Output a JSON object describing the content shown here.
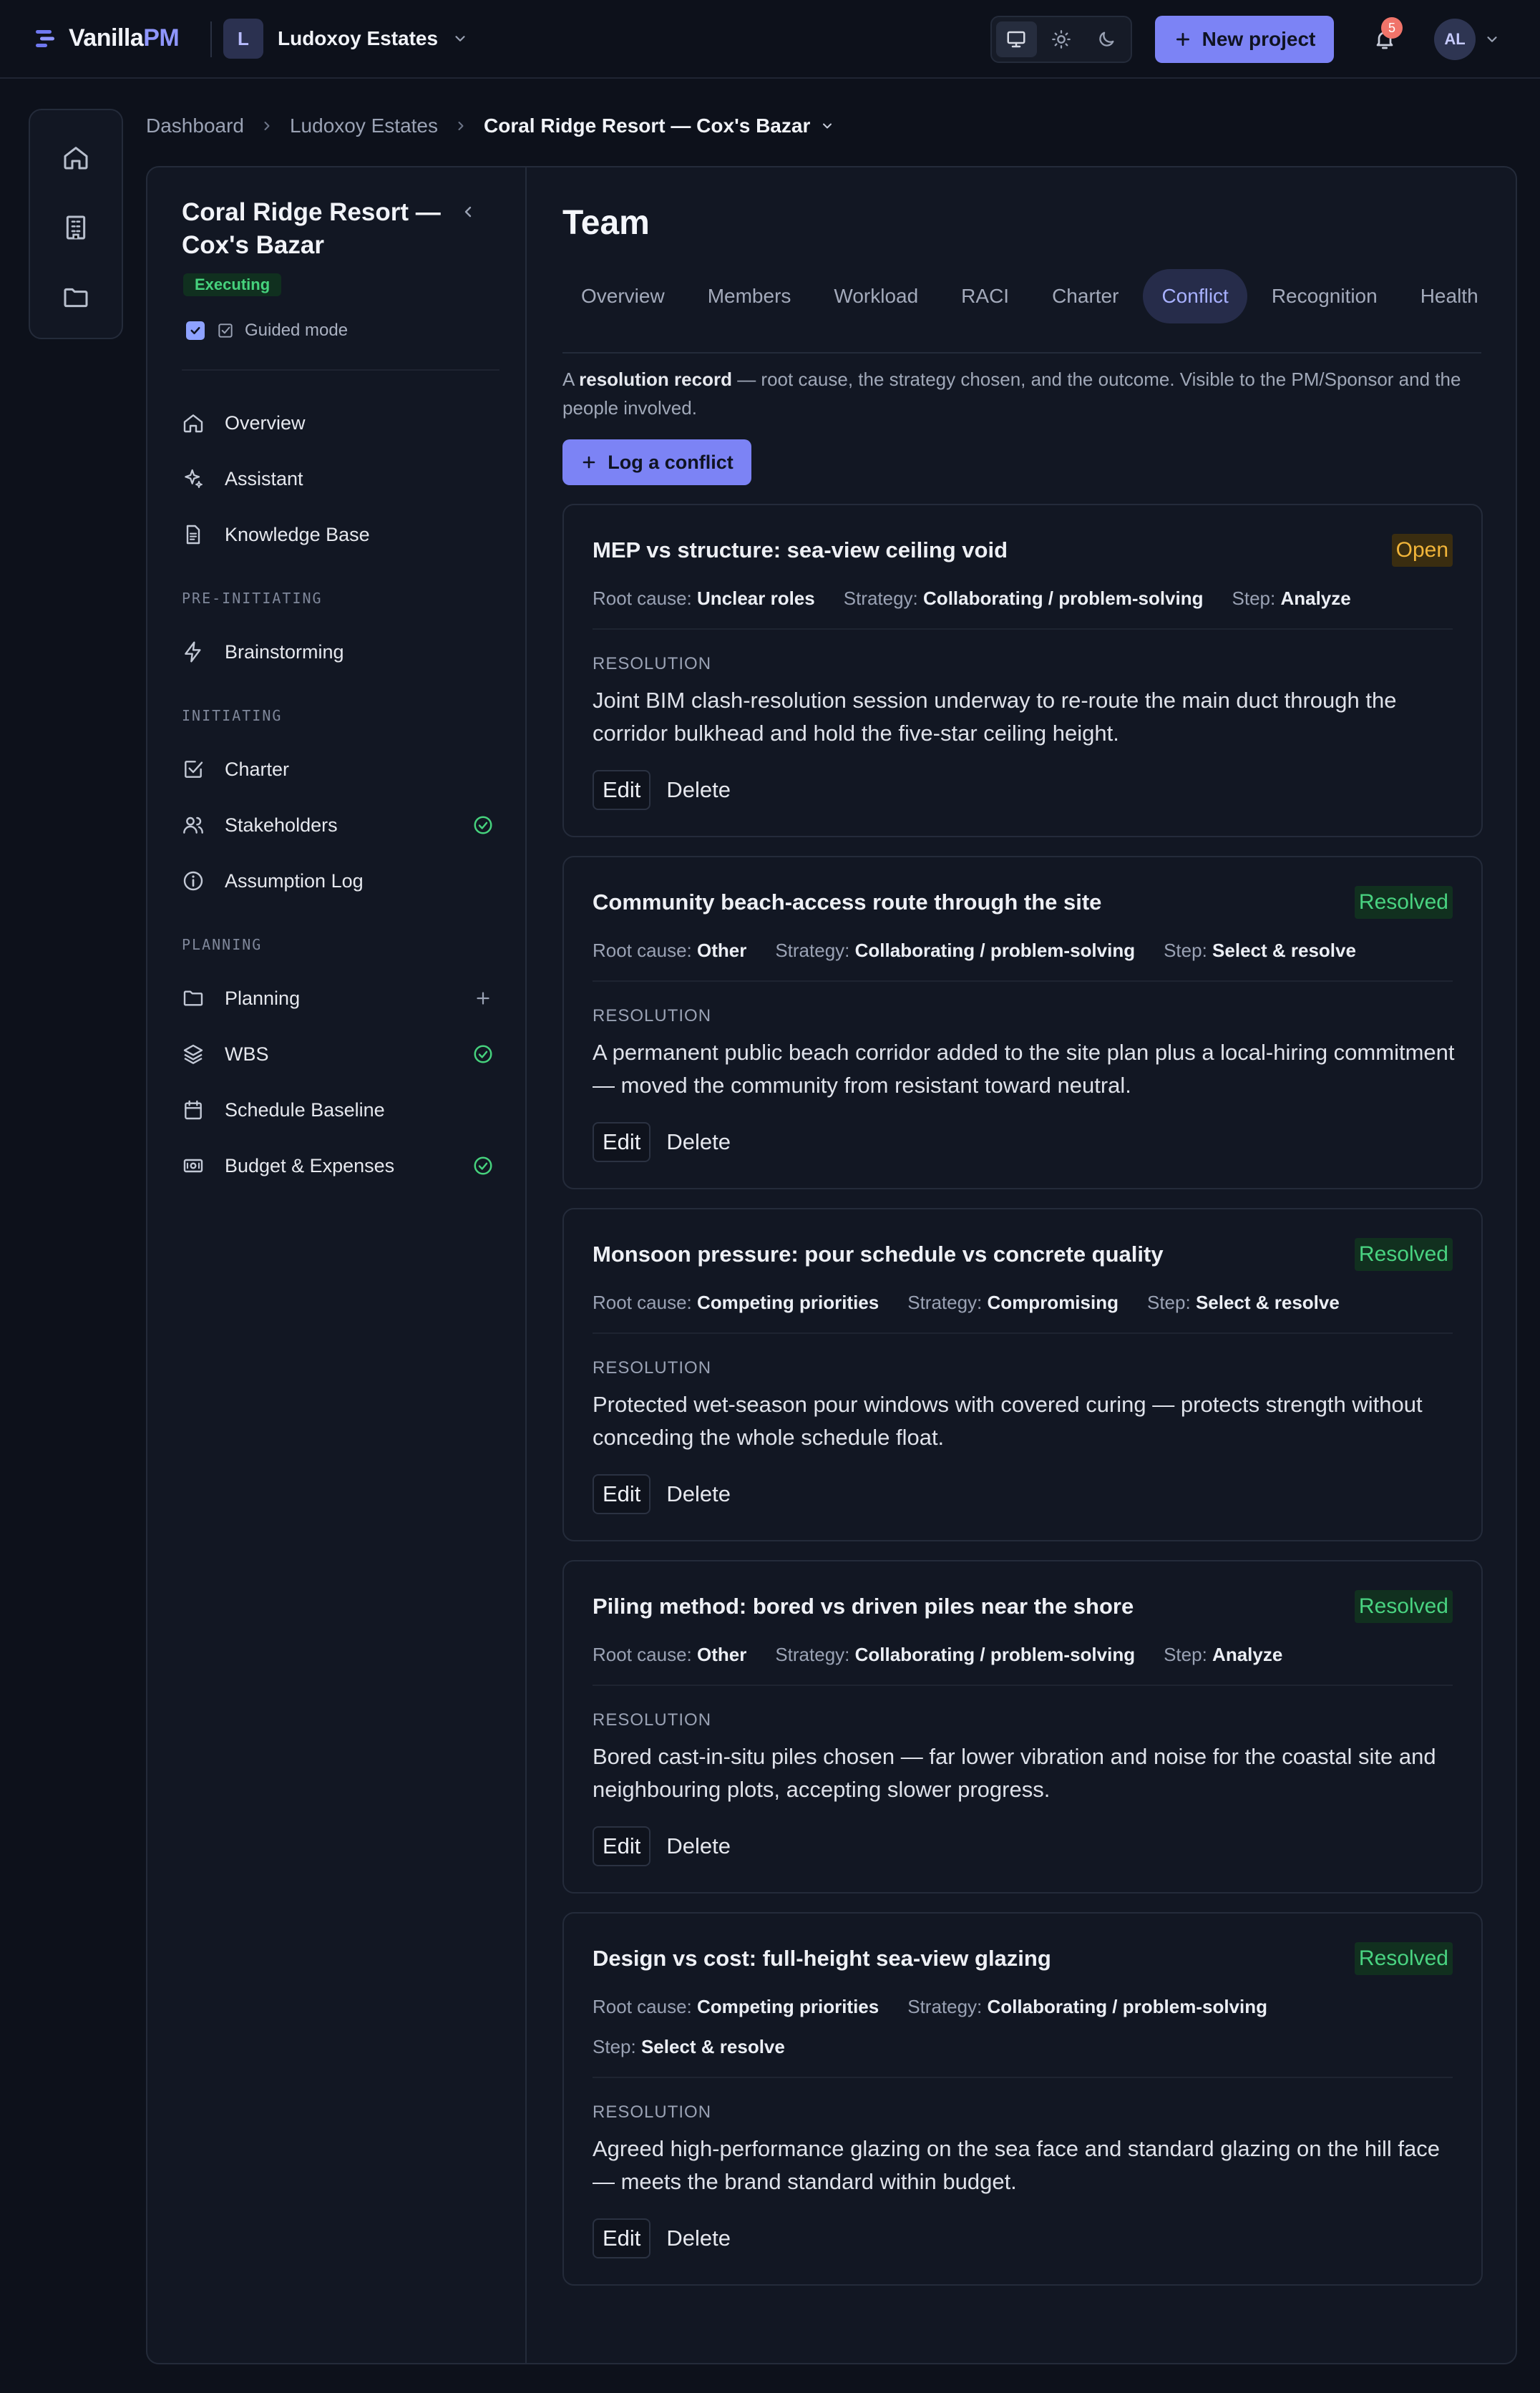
{
  "app": {
    "name_plain": "Vanilla",
    "name_accent": "PM",
    "workspace_initial": "L",
    "workspace_name": "Ludoxoy Estates",
    "new_project_label": "New project",
    "notification_count": "5",
    "user_initials": "AL",
    "accent_color": "#7c83f5"
  },
  "breadcrumb": {
    "items": [
      "Dashboard",
      "Ludoxoy Estates"
    ],
    "current": "Coral Ridge Resort — Cox's Bazar"
  },
  "sidebar": {
    "project_title": "Coral Ridge Resort — Cox's Bazar",
    "status": "Executing",
    "guided_mode_label": "Guided mode",
    "guided_mode_checked": true,
    "top_items": [
      {
        "label": "Overview",
        "icon": "home-icon"
      },
      {
        "label": "Assistant",
        "icon": "sparkle-icon"
      },
      {
        "label": "Knowledge Base",
        "icon": "document-icon"
      }
    ],
    "sections": [
      {
        "title": "PRE-INITIATING",
        "items": [
          {
            "label": "Brainstorming",
            "icon": "bolt-icon"
          }
        ]
      },
      {
        "title": "INITIATING",
        "items": [
          {
            "label": "Charter",
            "icon": "checkbox-icon"
          },
          {
            "label": "Stakeholders",
            "icon": "users-icon",
            "trail": "check-circle-icon"
          },
          {
            "label": "Assumption Log",
            "icon": "info-icon"
          }
        ]
      },
      {
        "title": "PLANNING",
        "items": [
          {
            "label": "Planning",
            "icon": "folder-icon",
            "trail": "plus-icon"
          },
          {
            "label": "WBS",
            "icon": "layers-icon",
            "trail": "check-circle-icon"
          },
          {
            "label": "Schedule Baseline",
            "icon": "calendar-icon"
          },
          {
            "label": "Budget & Expenses",
            "icon": "money-icon",
            "trail": "check-circle-icon"
          }
        ]
      }
    ]
  },
  "main": {
    "title": "Team",
    "tabs": [
      "Overview",
      "Members",
      "Workload",
      "RACI",
      "Charter",
      "Conflict",
      "Recognition",
      "Health"
    ],
    "active_tab": "Conflict",
    "intro_prefix": "A ",
    "intro_bold": "resolution record",
    "intro_suffix": " — root cause, the strategy chosen, and the outcome. Visible to the PM/Sponsor and the people involved.",
    "log_button_label": "Log a conflict",
    "labels": {
      "root_cause": "Root cause:",
      "strategy": "Strategy:",
      "step": "Step:",
      "resolution": "RESOLUTION",
      "edit": "Edit",
      "delete": "Delete"
    },
    "conflicts": [
      {
        "title": "MEP vs structure: sea-view ceiling void",
        "status": "Open",
        "root_cause": "Unclear roles",
        "strategy": "Collaborating / problem-solving",
        "step": "Analyze",
        "resolution": "Joint BIM clash-resolution session underway to re-route the main duct through the corridor bulkhead and hold the five-star ceiling height."
      },
      {
        "title": "Community beach-access route through the site",
        "status": "Resolved",
        "root_cause": "Other",
        "strategy": "Collaborating / problem-solving",
        "step": "Select & resolve",
        "resolution": "A permanent public beach corridor added to the site plan plus a local-hiring commitment — moved the community from resistant toward neutral."
      },
      {
        "title": "Monsoon pressure: pour schedule vs concrete quality",
        "status": "Resolved",
        "root_cause": "Competing priorities",
        "strategy": "Compromising",
        "step": "Select & resolve",
        "resolution": "Protected wet-season pour windows with covered curing — protects strength without conceding the whole schedule float."
      },
      {
        "title": "Piling method: bored vs driven piles near the shore",
        "status": "Resolved",
        "root_cause": "Other",
        "strategy": "Collaborating / problem-solving",
        "step": "Analyze",
        "resolution": "Bored cast-in-situ piles chosen — far lower vibration and noise for the coastal site and neighbouring plots, accepting slower progress."
      },
      {
        "title": "Design vs cost: full-height sea-view glazing",
        "status": "Resolved",
        "root_cause": "Competing priorities",
        "strategy": "Collaborating / problem-solving",
        "step": "Select & resolve",
        "resolution": "Agreed high-performance glazing on the sea face and standard glazing on the hill face — meets the brand standard within budget."
      }
    ]
  }
}
